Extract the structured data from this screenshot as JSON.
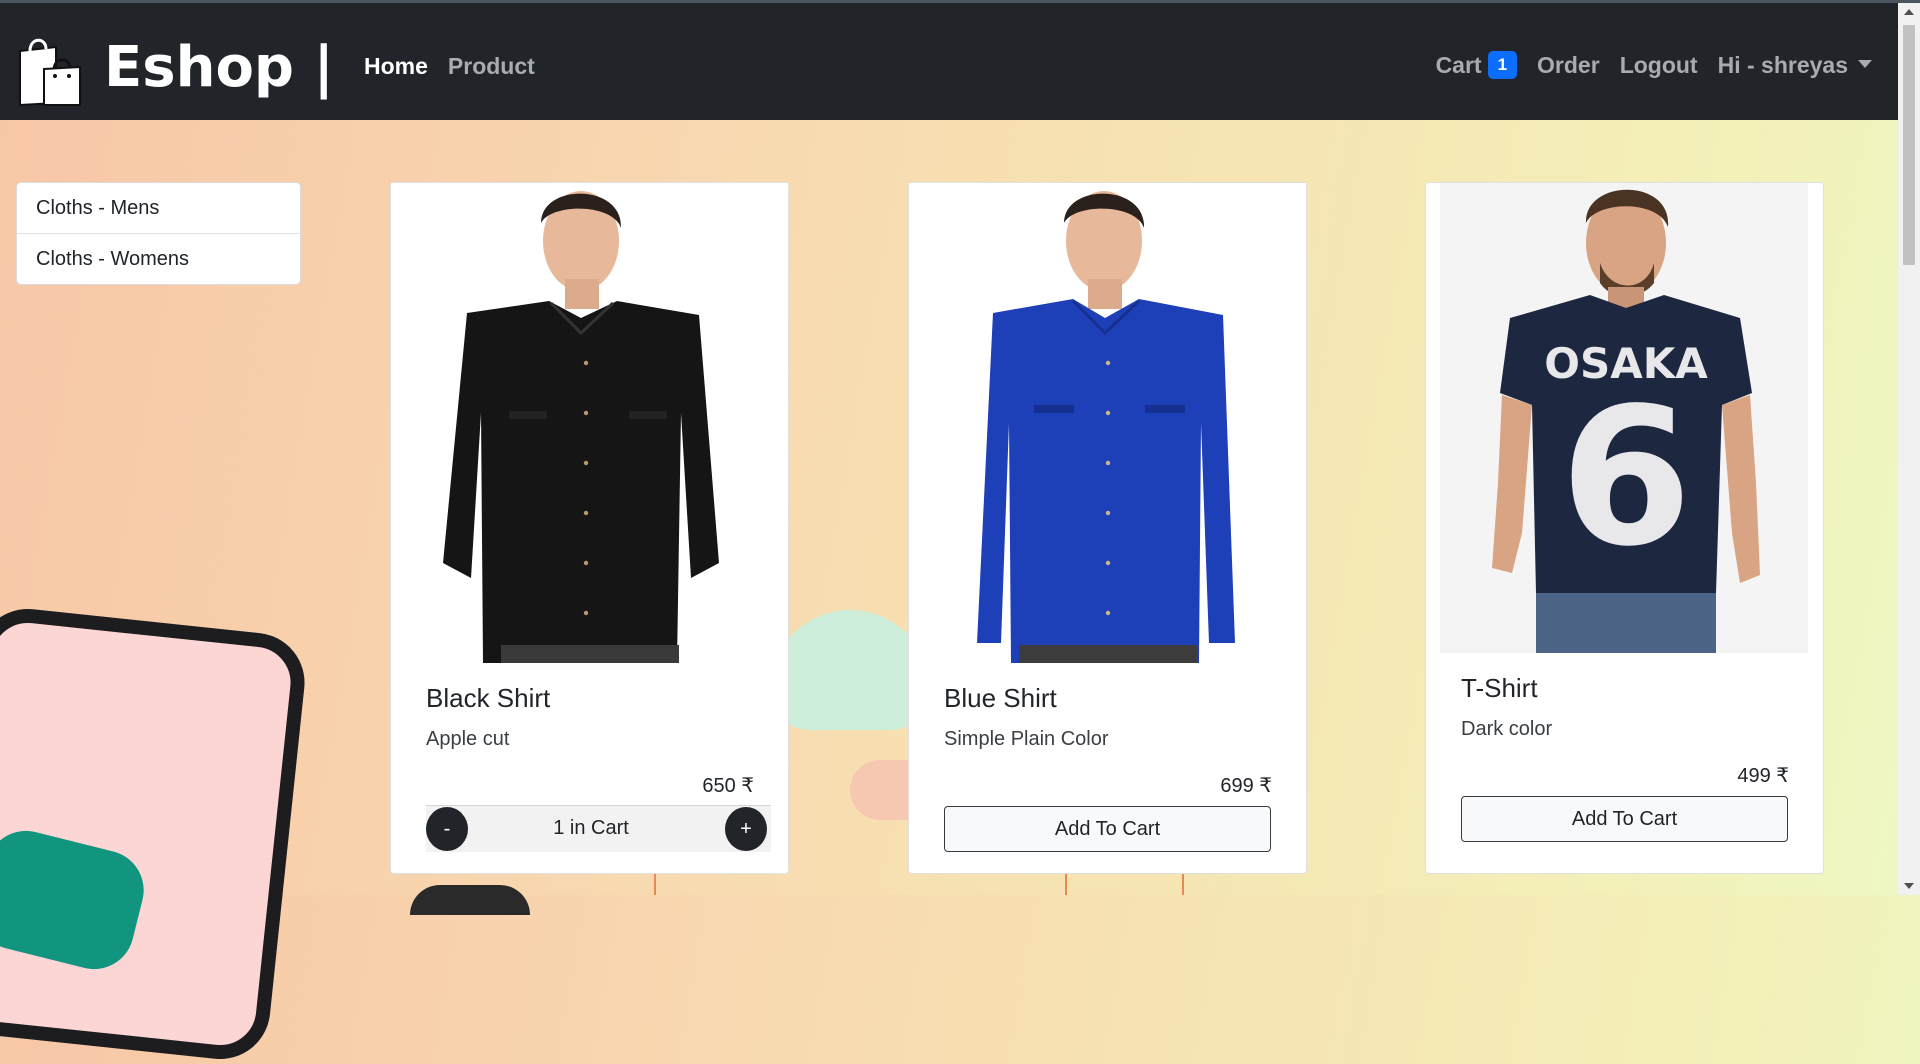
{
  "navbar": {
    "brand": "Eshop |",
    "links": [
      {
        "label": "Home",
        "active": true
      },
      {
        "label": "Product",
        "active": false
      }
    ],
    "cart_label": "Cart",
    "cart_count": "1",
    "order_label": "Order",
    "logout_label": "Logout",
    "user_label": "Hi - shreyas"
  },
  "categories": [
    "Cloths - Mens",
    "Cloths - Womens"
  ],
  "products": [
    {
      "title": "Black Shirt",
      "desc": "Apple cut",
      "price": "650 ₹",
      "in_cart": true,
      "cart_qty_label": "1 in Cart",
      "minus": "-",
      "plus": "+"
    },
    {
      "title": "Blue Shirt",
      "desc": "Simple Plain Color",
      "price": "699 ₹",
      "in_cart": false,
      "button": "Add To Cart"
    },
    {
      "title": "T-Shirt",
      "desc": "Dark color",
      "price": "499 ₹",
      "in_cart": false,
      "button": "Add To Cart",
      "tee_print": "OSAKA",
      "tee_number": "6"
    }
  ],
  "colors": {
    "navbar": "#212529",
    "badge": "#0d6efd",
    "shirt_black": "#151515",
    "shirt_blue": "#1d3fb8",
    "tee": "#1d2740"
  }
}
